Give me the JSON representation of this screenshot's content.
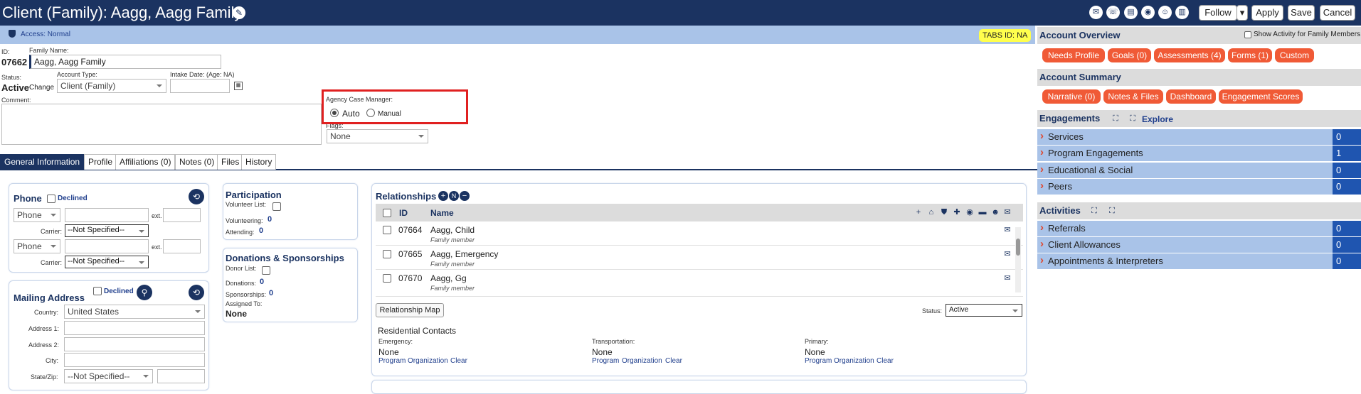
{
  "header": {
    "title": "Client (Family): Aagg, Aagg Family",
    "buttons": {
      "follow": "Follow",
      "apply": "Apply",
      "save": "Save",
      "cancel": "Cancel"
    }
  },
  "access": {
    "label": "Access: Normal",
    "tabs_id": "TABS ID: NA"
  },
  "client": {
    "id_label": "ID:",
    "id": "07662",
    "family_name_label": "Family Name:",
    "family_name": "Aagg, Aagg Family",
    "status_label": "Status:",
    "status": "Active",
    "change": "Change",
    "account_type_label": "Account Type:",
    "account_type": "Client (Family)",
    "intake_label": "Intake Date: (Age: NA)",
    "comment_label": "Comment:",
    "case_manager_label": "Agency Case Manager:",
    "auto": "Auto",
    "manual": "Manual",
    "flags_label": "Flags:",
    "flags_value": "None"
  },
  "tabs": [
    "General Information",
    "Profile",
    "Affiliations (0)",
    "Notes (0)",
    "Files",
    "History"
  ],
  "phone": {
    "title": "Phone",
    "declined": "Declined",
    "type": "Phone",
    "ext": "ext.",
    "carrier_label": "Carrier:",
    "carrier": "--Not Specified--"
  },
  "mailing": {
    "title": "Mailing Address",
    "declined": "Declined",
    "country_label": "Country:",
    "country": "United States",
    "address1_label": "Address 1:",
    "address2_label": "Address 2:",
    "city_label": "City:",
    "statezip_label": "State/Zip:",
    "state": "--Not Specified--"
  },
  "participation": {
    "title": "Participation",
    "volunteer_list": "Volunteer List:",
    "volunteering_label": "Volunteering:",
    "volunteering": "0",
    "attending_label": "Attending:",
    "attending": "0"
  },
  "donations": {
    "title": "Donations & Sponsorships",
    "donor_list": "Donor List:",
    "donations_label": "Donations:",
    "donations": "0",
    "sponsorships_label": "Sponsorships:",
    "sponsorships": "0",
    "assigned_label": "Assigned To:",
    "assigned": "None"
  },
  "relationships": {
    "title": "Relationships",
    "col_id": "ID",
    "col_name": "Name",
    "rows": [
      {
        "id": "07664",
        "name": "Aagg, Child",
        "role": "Family member"
      },
      {
        "id": "07665",
        "name": "Aagg, Emergency",
        "role": "Family member"
      },
      {
        "id": "07670",
        "name": "Aagg, Gg",
        "role": "Family member"
      }
    ],
    "map_button": "Relationship Map",
    "status_label": "Status:",
    "status": "Active"
  },
  "residential": {
    "title": "Residential Contacts",
    "emergency_label": "Emergency:",
    "emergency": "None",
    "transport_label": "Transportation:",
    "transport": "None",
    "primary_label": "Primary:",
    "primary": "None",
    "program": "Program",
    "organization": "Organization",
    "clear": "Clear"
  },
  "overview": {
    "title": "Account Overview",
    "show_activity": "Show Activity for Family Members",
    "buttons": [
      "Needs Profile",
      "Goals (0)",
      "Assessments (4)",
      "Forms (1)",
      "Custom"
    ]
  },
  "summary": {
    "title": "Account Summary",
    "buttons": [
      "Narrative (0)",
      "Notes & Files",
      "Dashboard",
      "Engagement Scores"
    ]
  },
  "engagements": {
    "title": "Engagements",
    "explore": "Explore",
    "rows": [
      {
        "label": "Services",
        "count": "0"
      },
      {
        "label": "Program Engagements",
        "count": "1"
      },
      {
        "label": "Educational & Social",
        "count": "0"
      },
      {
        "label": "Peers",
        "count": "0"
      }
    ]
  },
  "activities": {
    "title": "Activities",
    "rows": [
      {
        "label": "Referrals",
        "count": "0"
      },
      {
        "label": "Client Allowances",
        "count": "0"
      },
      {
        "label": "Appointments & Interpreters",
        "count": "0"
      }
    ]
  }
}
